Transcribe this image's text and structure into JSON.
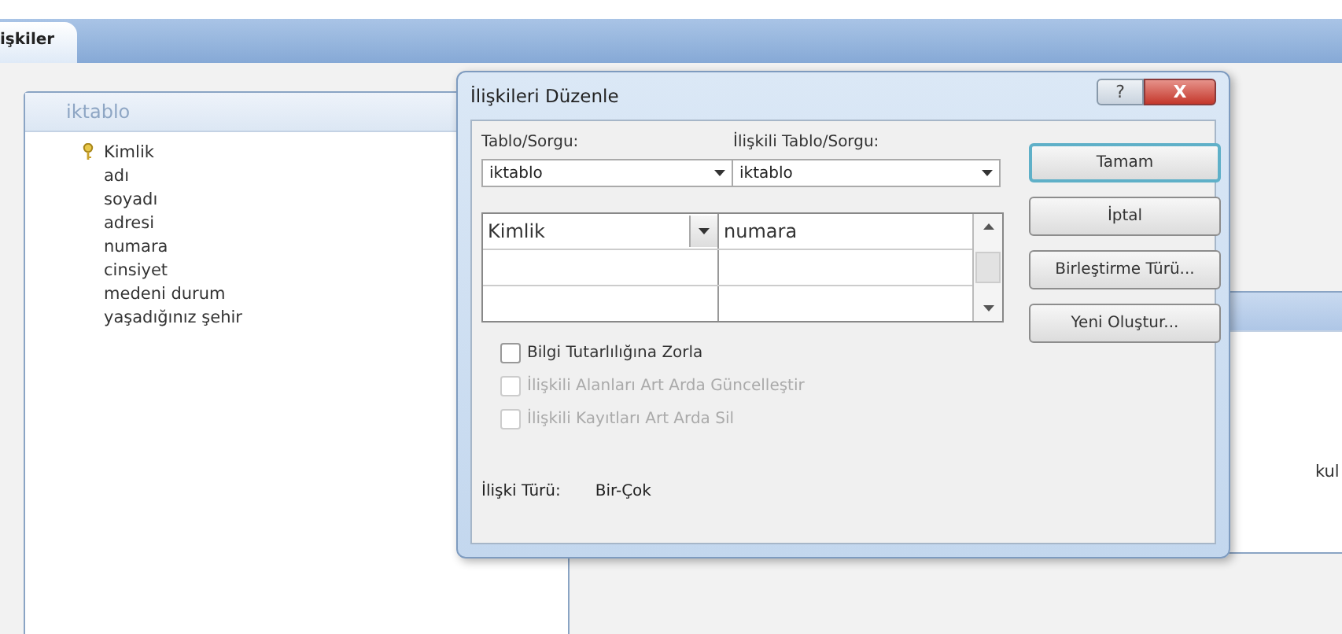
{
  "document_tab": {
    "label": "işkiler",
    "selected": true
  },
  "tables": [
    {
      "title": "iktablo",
      "fields": [
        {
          "name": "Kimlik",
          "primary_key": true
        },
        {
          "name": "adı",
          "primary_key": false
        },
        {
          "name": "soyadı",
          "primary_key": false
        },
        {
          "name": "adresi",
          "primary_key": false
        },
        {
          "name": "numara",
          "primary_key": false
        },
        {
          "name": "cinsiyet",
          "primary_key": false
        },
        {
          "name": "medeni durum",
          "primary_key": false
        },
        {
          "name": "yaşadığınız şehir",
          "primary_key": false
        }
      ]
    },
    {
      "fields": [
        {
          "name": "kul",
          "primary_key": false
        }
      ]
    }
  ],
  "dialog": {
    "title": "İlişkileri Düzenle",
    "help_button": "?",
    "close_button": "X",
    "table_label": "Tablo/Sorgu:",
    "related_label": "İlişkili Tablo/Sorgu:",
    "table": "iktablo",
    "related_table": "iktablo",
    "rows": [
      {
        "field": "Kimlik",
        "related": "numara"
      }
    ],
    "checkboxes": [
      {
        "label": "Bilgi Tutarlılığına Zorla",
        "checked": false,
        "disabled": false
      },
      {
        "label": "İlişkili Alanları Art Arda Güncelleştir",
        "checked": false,
        "disabled": true
      },
      {
        "label": "İlişkili Kayıtları Art Arda Sil",
        "checked": false,
        "disabled": true
      }
    ],
    "relation_type_label": "İlişki Türü:",
    "relation_type": "Bir-Çok",
    "buttons": [
      {
        "label": "Tamam",
        "default": true
      },
      {
        "label": "İptal",
        "default": false
      },
      {
        "label": "Birleştirme Türü...",
        "default": false
      },
      {
        "label": "Yeni Oluştur...",
        "default": false
      }
    ]
  }
}
